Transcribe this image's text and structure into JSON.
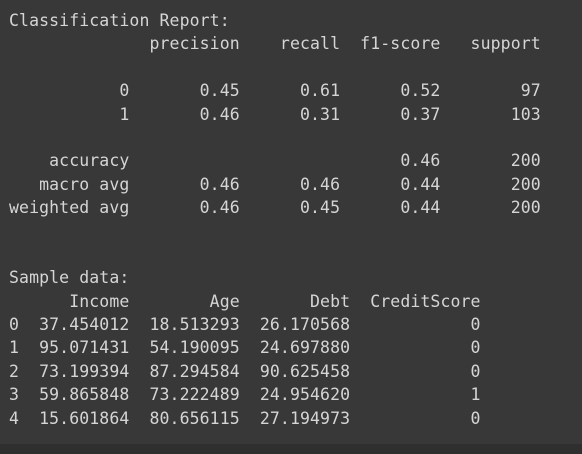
{
  "console": {
    "lines": [
      "Classification Report:",
      "              precision    recall  f1-score   support",
      "",
      "           0       0.45      0.61      0.52        97",
      "           1       0.46      0.31      0.37       103",
      "",
      "    accuracy                           0.46       200",
      "   macro avg       0.46      0.46      0.44       200",
      "weighted avg       0.46      0.45      0.44       200",
      "",
      "",
      "Sample data:",
      "      Income        Age       Debt  CreditScore",
      "0  37.454012  18.513293  26.170568            0",
      "1  95.071431  54.190095  24.697880            0",
      "2  73.199394  87.294584  90.625458            0",
      "3  59.865848  73.222489  24.954620            1",
      "4  15.601864  80.656115  27.194973            0"
    ]
  }
}
